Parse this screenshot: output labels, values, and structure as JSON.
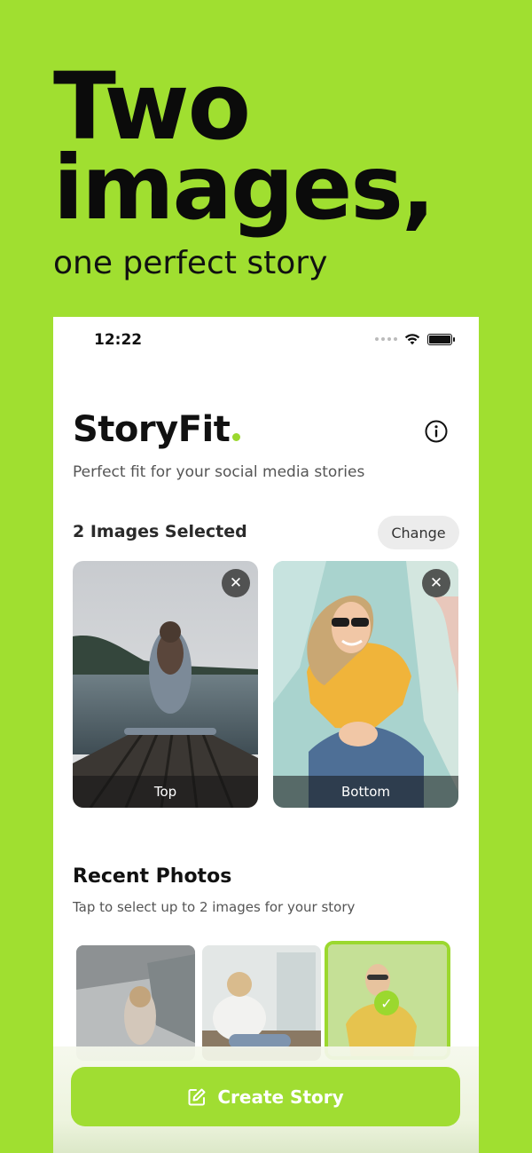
{
  "hero": {
    "line1": "Two",
    "line2": "images,",
    "subline": "one perfect story"
  },
  "status_bar": {
    "time": "12:22"
  },
  "app": {
    "name": "StoryFit",
    "subtitle": "Perfect fit for your social media stories",
    "accent_color": "#9bd82e",
    "info_icon": "info-circle-icon"
  },
  "selection": {
    "label": "2 Images Selected",
    "change_button": "Change",
    "cards": [
      {
        "label": "Top",
        "close_icon": "close-icon"
      },
      {
        "label": "Bottom",
        "close_icon": "close-icon"
      }
    ]
  },
  "recent": {
    "title": "Recent Photos",
    "subtitle": "Tap to select up to 2 images for your story",
    "thumbnails": [
      {
        "selected": false
      },
      {
        "selected": false
      },
      {
        "selected": true,
        "check_icon": "checkmark-icon"
      }
    ]
  },
  "cta": {
    "label": "Create Story",
    "icon": "edit-icon"
  },
  "colors": {
    "background": "#a0df30",
    "button": "#a0dd32",
    "text": "#111111"
  }
}
